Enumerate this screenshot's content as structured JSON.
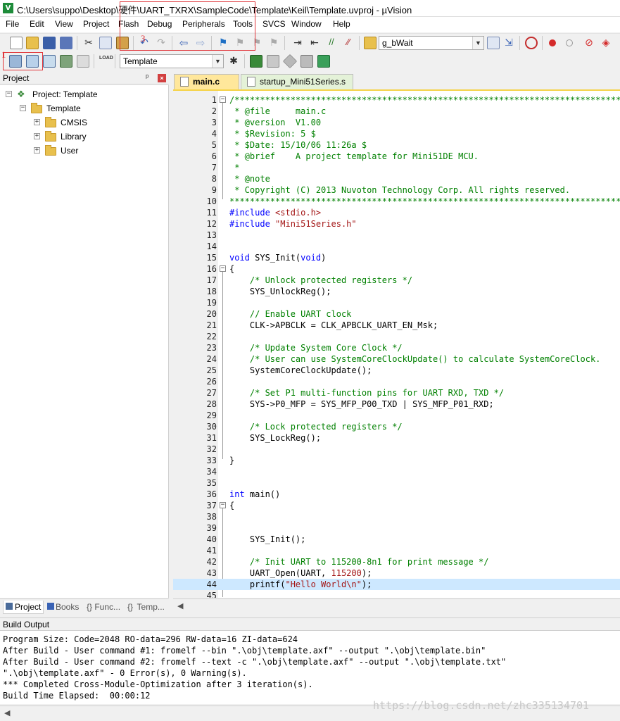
{
  "window": {
    "title": "C:\\Users\\suppo\\Desktop\\硬件\\UART_TXRX\\SampleCode\\Template\\Keil\\Template.uvproj - µVision"
  },
  "menu": [
    "File",
    "Edit",
    "View",
    "Project",
    "Flash",
    "Debug",
    "Peripherals",
    "Tools",
    "SVCS",
    "Window",
    "Help"
  ],
  "toolbar": {
    "find_value": "g_bWait",
    "target_value": "Template"
  },
  "annotations": {
    "label1": "1",
    "label3": "3"
  },
  "project_panel": {
    "title": "Project",
    "pin": "ᵖ",
    "close": "×",
    "tree": [
      {
        "label": "Project: Template",
        "level": 0
      },
      {
        "label": "Template",
        "level": 1
      },
      {
        "label": "CMSIS",
        "level": 2
      },
      {
        "label": "Library",
        "level": 2
      },
      {
        "label": "User",
        "level": 2
      }
    ],
    "tabs": [
      "Project",
      "Books",
      "{} Func...",
      "{}  Temp..."
    ]
  },
  "editor": {
    "tabs": [
      {
        "label": "main.c",
        "active": true
      },
      {
        "label": "startup_Mini51Series.s",
        "active": false
      }
    ],
    "highlight_line": 44,
    "lines": [
      {
        "n": "1",
        "t": "/*****************************************************************************************",
        "c": "cmt"
      },
      {
        "n": "2",
        "t": " * @file     main.c",
        "c": "cmt"
      },
      {
        "n": "3",
        "t": " * @version  V1.00",
        "c": "cmt"
      },
      {
        "n": "4",
        "t": " * $Revision: 5 $",
        "c": "cmt"
      },
      {
        "n": "5",
        "t": " * $Date: 15/10/06 11:26a $",
        "c": "cmt"
      },
      {
        "n": "6",
        "t": " * @brief    A project template for Mini51DE MCU.",
        "c": "cmt"
      },
      {
        "n": "7",
        "t": " *",
        "c": "cmt"
      },
      {
        "n": "8",
        "t": " * @note",
        "c": "cmt"
      },
      {
        "n": "9",
        "t": " * Copyright (C) 2013 Nuvoton Technology Corp. All rights reserved.",
        "c": "cmt"
      },
      {
        "n": "10",
        "t": "******************************************************************************************",
        "c": "cmt"
      },
      {
        "n": "11",
        "t": "#include <stdio.h>",
        "c": "inc"
      },
      {
        "n": "12",
        "t": "#include \"Mini51Series.h\"",
        "c": "inc"
      },
      {
        "n": "13",
        "t": "",
        "c": ""
      },
      {
        "n": "14",
        "t": "",
        "c": ""
      },
      {
        "n": "15",
        "t": "void SYS_Init(void)",
        "c": "fn"
      },
      {
        "n": "16",
        "t": "{",
        "c": ""
      },
      {
        "n": "17",
        "t": "    /* Unlock protected registers */",
        "c": "cmt"
      },
      {
        "n": "18",
        "t": "    SYS_UnlockReg();",
        "c": ""
      },
      {
        "n": "19",
        "t": "",
        "c": ""
      },
      {
        "n": "20",
        "t": "    // Enable UART clock",
        "c": "cmt"
      },
      {
        "n": "21",
        "t": "    CLK->APBCLK = CLK_APBCLK_UART_EN_Msk;",
        "c": ""
      },
      {
        "n": "22",
        "t": "",
        "c": ""
      },
      {
        "n": "23",
        "t": "    /* Update System Core Clock */",
        "c": "cmt"
      },
      {
        "n": "24",
        "t": "    /* User can use SystemCoreClockUpdate() to calculate SystemCoreClock.",
        "c": "cmt"
      },
      {
        "n": "25",
        "t": "    SystemCoreClockUpdate();",
        "c": ""
      },
      {
        "n": "26",
        "t": "",
        "c": ""
      },
      {
        "n": "27",
        "t": "    /* Set P1 multi-function pins for UART RXD, TXD */",
        "c": "cmt"
      },
      {
        "n": "28",
        "t": "    SYS->P0_MFP = SYS_MFP_P00_TXD | SYS_MFP_P01_RXD;",
        "c": ""
      },
      {
        "n": "29",
        "t": "",
        "c": ""
      },
      {
        "n": "30",
        "t": "    /* Lock protected registers */",
        "c": "cmt"
      },
      {
        "n": "31",
        "t": "    SYS_LockReg();",
        "c": ""
      },
      {
        "n": "32",
        "t": "",
        "c": ""
      },
      {
        "n": "33",
        "t": "}",
        "c": ""
      },
      {
        "n": "34",
        "t": "",
        "c": ""
      },
      {
        "n": "35",
        "t": "",
        "c": ""
      },
      {
        "n": "36",
        "t": "int main()",
        "c": "main"
      },
      {
        "n": "37",
        "t": "{",
        "c": ""
      },
      {
        "n": "38",
        "t": "",
        "c": ""
      },
      {
        "n": "39",
        "t": "",
        "c": ""
      },
      {
        "n": "40",
        "t": "    SYS_Init();",
        "c": ""
      },
      {
        "n": "41",
        "t": "",
        "c": ""
      },
      {
        "n": "42",
        "t": "    /* Init UART to 115200-8n1 for print message */",
        "c": "cmt"
      },
      {
        "n": "43",
        "t": "    UART_Open(UART, 115200);",
        "c": "num"
      },
      {
        "n": "44",
        "t": "    printf(\"Hello World\\n\");",
        "c": "pf"
      },
      {
        "n": "45",
        "t": "",
        "c": ""
      }
    ]
  },
  "build_output": {
    "title": "Build Output",
    "lines": [
      "Program Size: Code=2048 RO-data=296 RW-data=16 ZI-data=624",
      "After Build - User command #1: fromelf --bin \".\\obj\\template.axf\" --output \".\\obj\\template.bin\"",
      "After Build - User command #2: fromelf --text -c \".\\obj\\template.axf\" --output \".\\obj\\template.txt\"",
      "\".\\obj\\template.axf\" - 0 Error(s), 0 Warning(s).",
      "*** Completed Cross-Module-Optimization after 3 iteration(s).",
      "Build Time Elapsed:  00:00:12"
    ]
  },
  "watermark": "https://blog.csdn.net/zhc335134701"
}
